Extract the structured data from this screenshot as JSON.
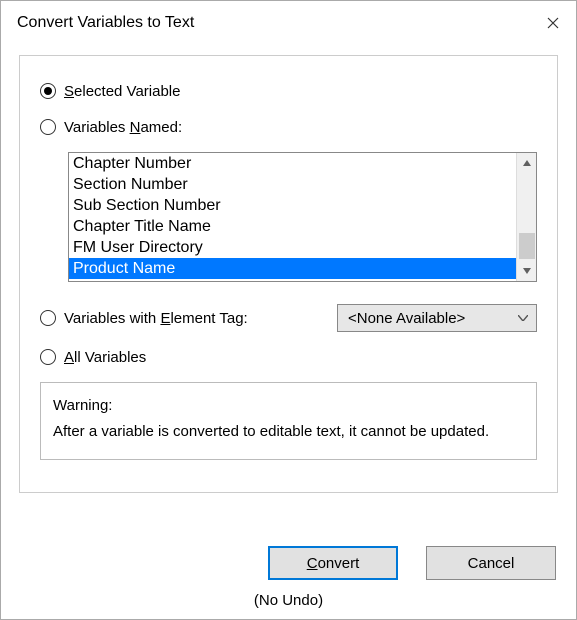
{
  "window": {
    "title": "Convert Variables to Text"
  },
  "radios": {
    "selected_variable": "Selected Variable",
    "variables_named": "Variables Named:",
    "variables_named_und": "N",
    "with_element_tag": "Variables with Element Tag:",
    "with_element_tag_und": "E",
    "all_variables": "All Variables",
    "all_variables_und": "A",
    "selected_variable_und": "S"
  },
  "list": {
    "items": [
      "Chapter Number",
      "Section Number",
      "Sub Section Number",
      "Chapter Title Name",
      "FM User Directory",
      "Product Name"
    ],
    "selected_index": 5
  },
  "dropdown": {
    "value": "<None Available>"
  },
  "warning": {
    "heading": "Warning:",
    "body": "After a variable is converted to editable text, it cannot be updated."
  },
  "buttons": {
    "convert": "Convert",
    "convert_und": "C",
    "cancel": "Cancel"
  },
  "footer": {
    "no_undo": "(No Undo)"
  }
}
